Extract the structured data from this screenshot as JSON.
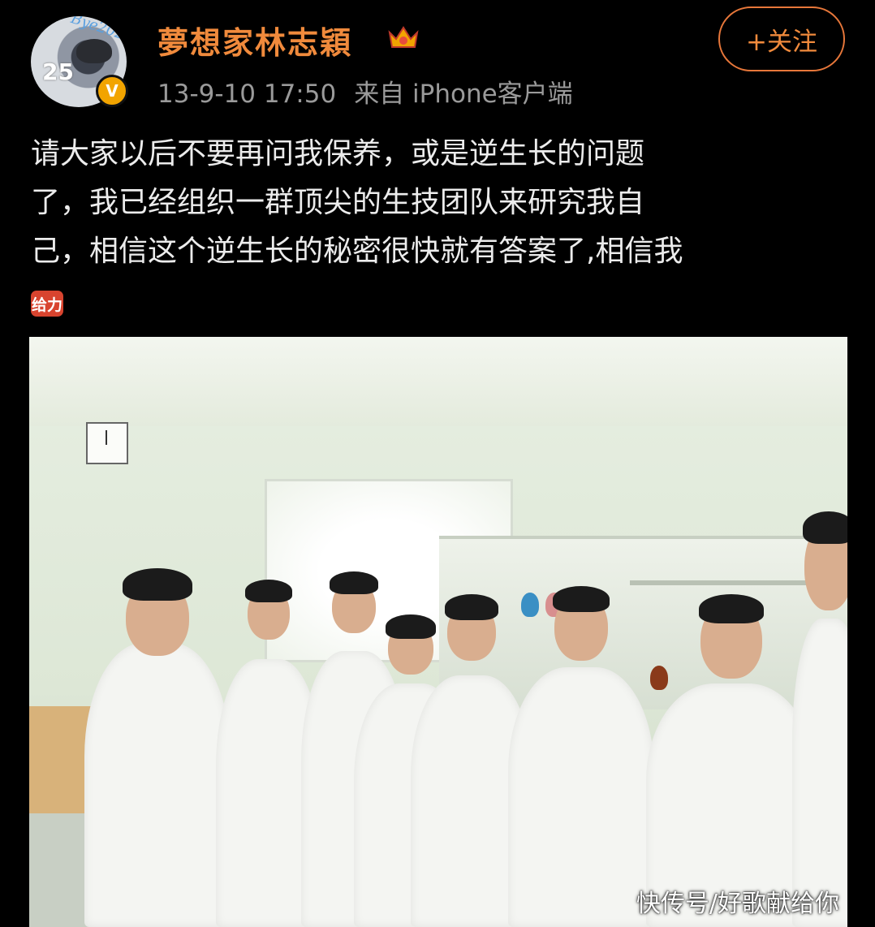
{
  "header": {
    "avatar_badge_text": "Bye2020",
    "avatar_number": "25",
    "verified_badge": "V",
    "username": "夢想家林志穎",
    "timestamp": "13-9-10 17:50",
    "source": "来自 iPhone客户端",
    "follow_button": "+关注"
  },
  "post": {
    "lines": [
      "请大家以后不要再问我保养，或是逆生长的问题",
      "了，我已经组织一群顶尖的生技团队来研究我自",
      "己，相信这个逆生长的秘密很快就有答案了,相信我"
    ],
    "emote_label": "给力"
  },
  "photo": {
    "watermark": "快传号/好歌献给你"
  },
  "colors": {
    "accent": "#f08a3c",
    "verified": "#f2a400",
    "background": "#000000"
  }
}
